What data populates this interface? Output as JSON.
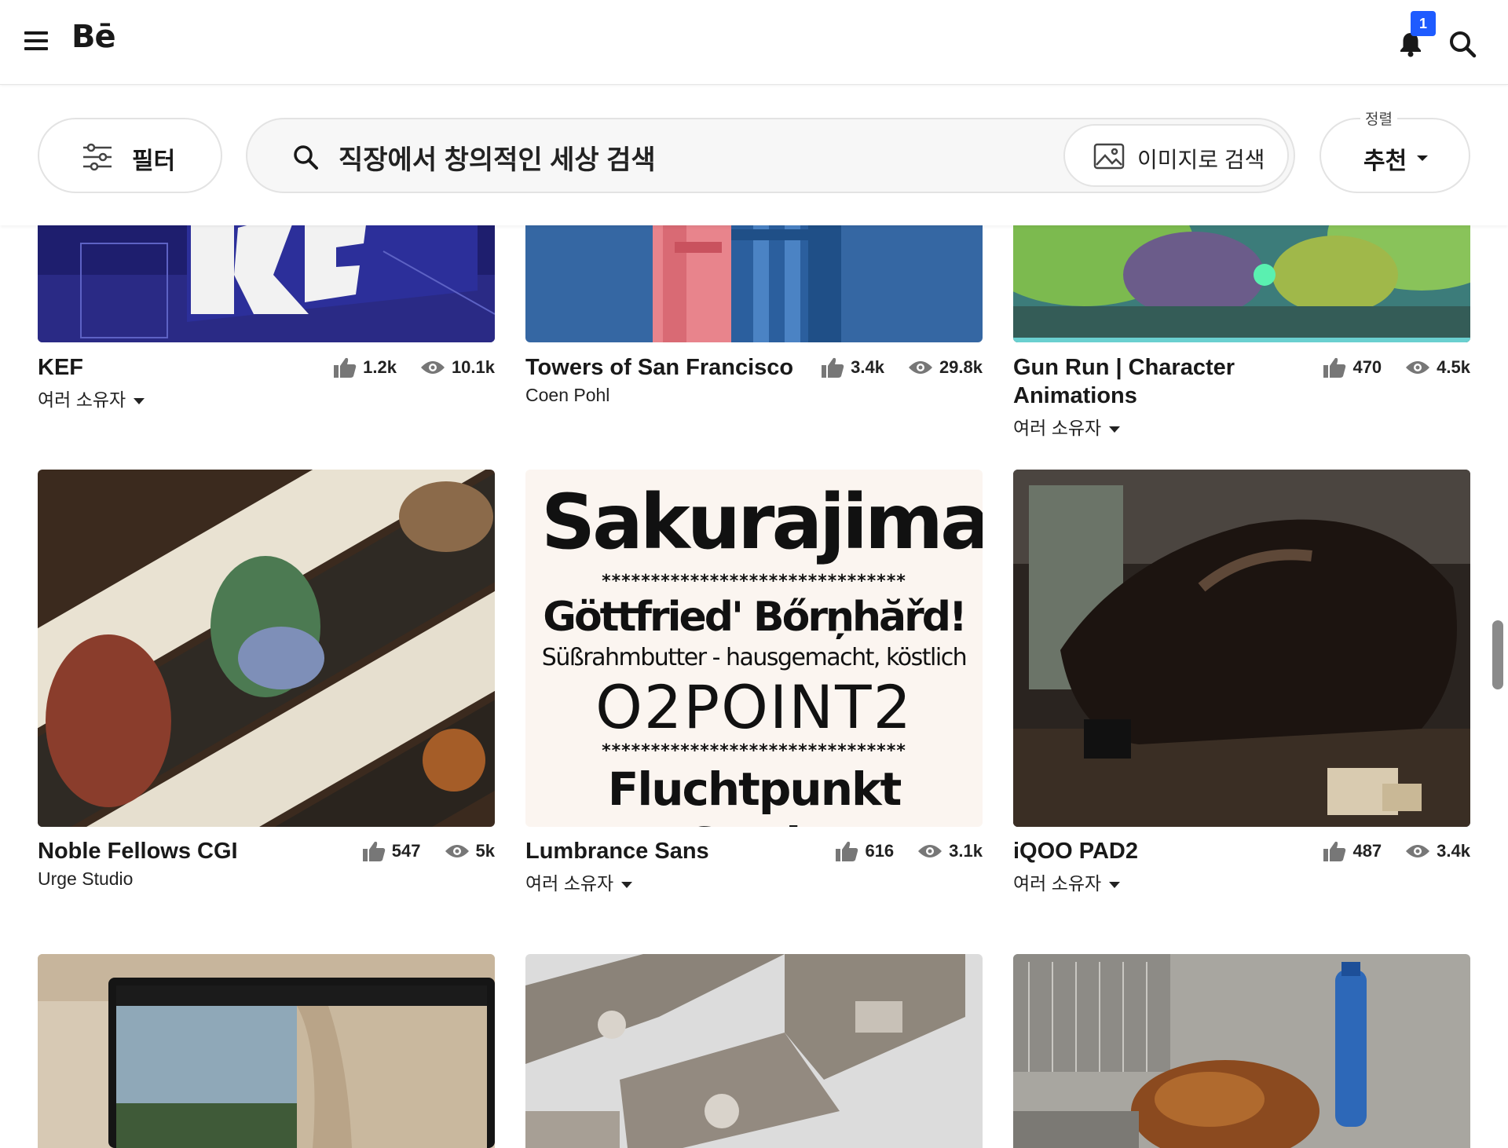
{
  "header": {
    "logo": "Bē",
    "notification_count": "1"
  },
  "filters": {
    "filter_label": "필터",
    "search_placeholder": "직장에서 창의적인 세상 검색",
    "image_search_label": "이미지로 검색",
    "sort_caption": "정렬",
    "sort_value": "추천"
  },
  "projects": [
    {
      "title": "KEF",
      "owner": "여러 소유자",
      "multi_owner": true,
      "likes": "1.2k",
      "views": "10.1k"
    },
    {
      "title": "Towers of San Francisco",
      "owner": "Coen Pohl",
      "multi_owner": false,
      "likes": "3.4k",
      "views": "29.8k"
    },
    {
      "title": "Gun Run | Character Animations",
      "owner": "여러 소유자",
      "multi_owner": true,
      "likes": "470",
      "views": "4.5k"
    },
    {
      "title": "Noble Fellows CGI",
      "owner": "Urge Studio",
      "multi_owner": false,
      "likes": "547",
      "views": "5k"
    },
    {
      "title": "Lumbrance Sans",
      "owner": "여러 소유자",
      "multi_owner": true,
      "likes": "616",
      "views": "3.1k"
    },
    {
      "title": "iQOO PAD2",
      "owner": "여러 소유자",
      "multi_owner": true,
      "likes": "487",
      "views": "3.4k"
    }
  ],
  "font_specimen": {
    "line1": "Sakurajima",
    "stars": "*******************************",
    "line2": "Göttfried' Bőrņhăřd!",
    "line3": "Süßrahmbutter - hausgemacht, köstlich",
    "line4": "O2POINT2",
    "line5": "Fluchtpunkt Stadt"
  },
  "colors": {
    "accent": "#1e5bff",
    "text": "#191919",
    "border": "#e3e3e3"
  }
}
